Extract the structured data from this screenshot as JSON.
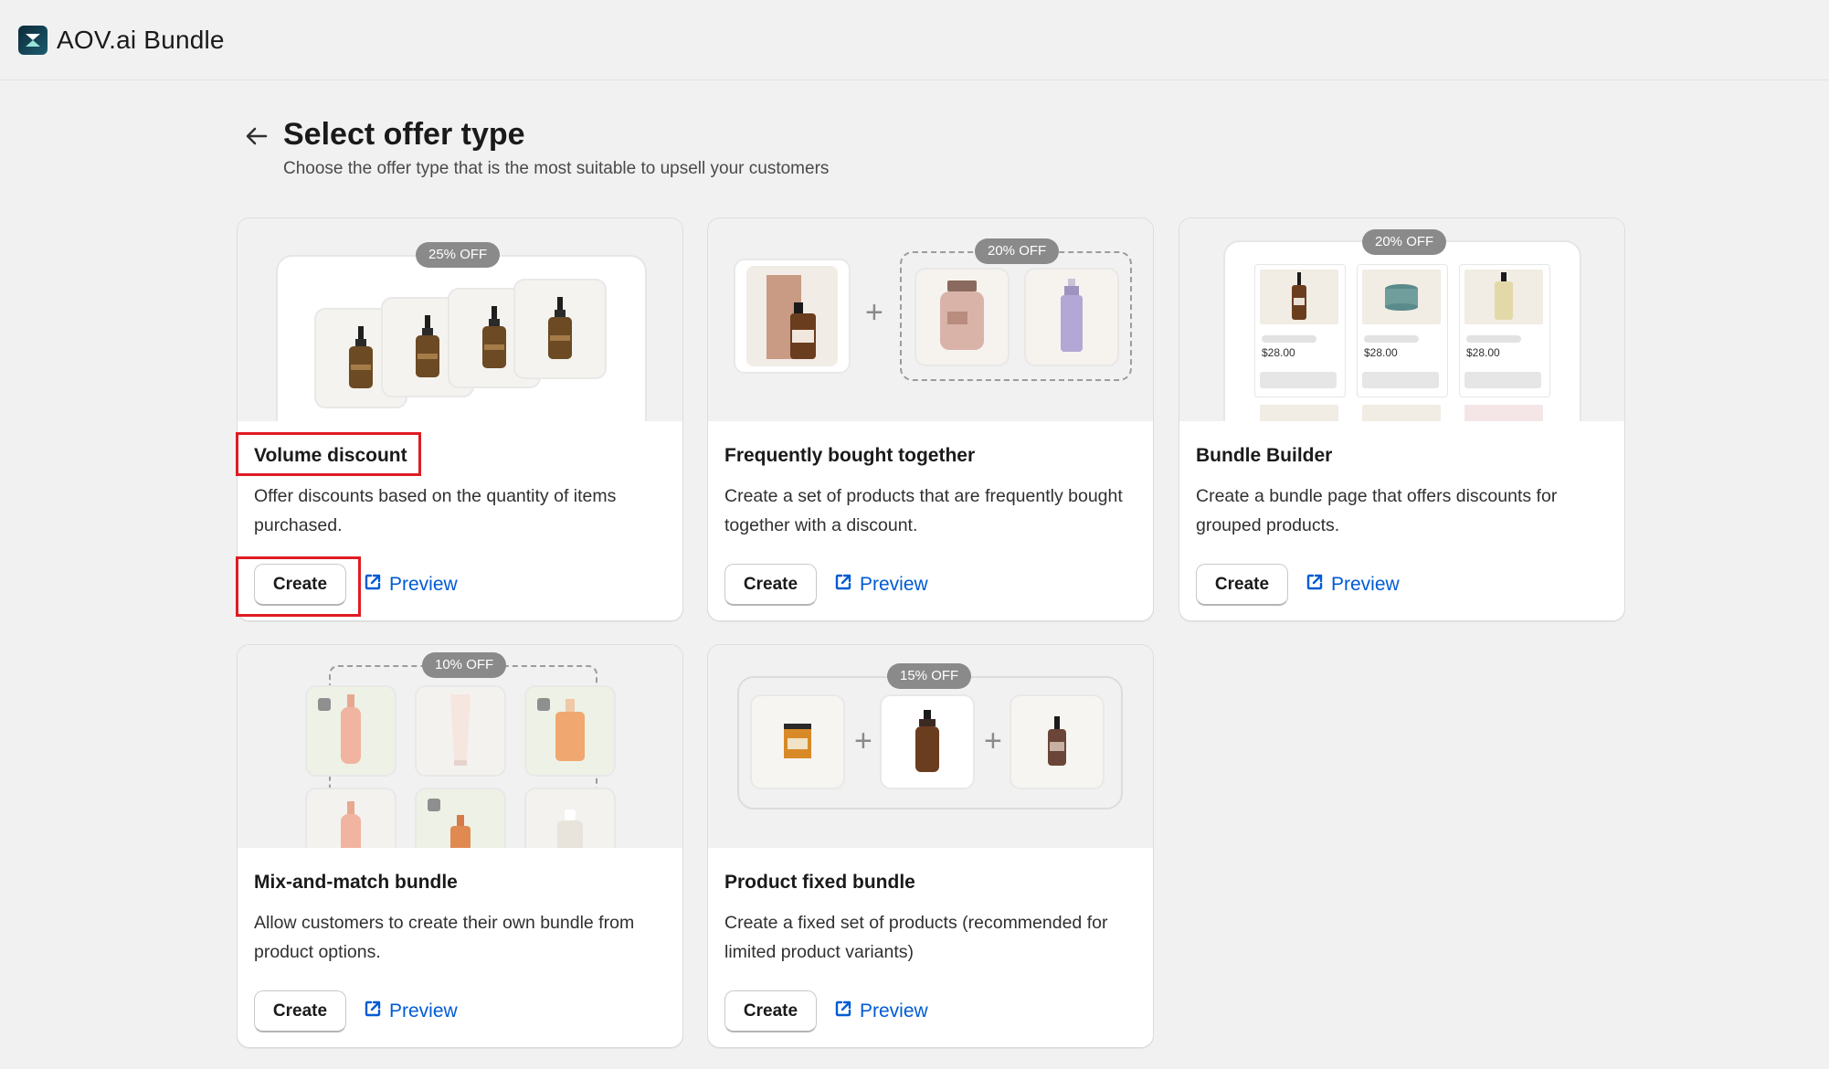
{
  "app": {
    "title": "AOV.ai Bundle"
  },
  "page": {
    "title": "Select offer type",
    "subtitle": "Choose the offer type that is the most suitable to upsell your customers"
  },
  "cards": [
    {
      "title": "Volume discount",
      "description": "Offer discounts based on the quantity of items purchased.",
      "badge": "25% OFF",
      "create_label": "Create",
      "preview_label": "Preview"
    },
    {
      "title": "Frequently bought together",
      "description": "Create a set of products that are frequently bought together with a discount.",
      "badge": "20% OFF",
      "create_label": "Create",
      "preview_label": "Preview"
    },
    {
      "title": "Bundle Builder",
      "description": "Create a bundle page that offers discounts for grouped products.",
      "badge": "20% OFF",
      "create_label": "Create",
      "preview_label": "Preview",
      "prices": [
        "$28.00",
        "$28.00",
        "$28.00"
      ]
    },
    {
      "title": "Mix-and-match bundle",
      "description": "Allow customers to create their own bundle from product options.",
      "badge": "10% OFF",
      "create_label": "Create",
      "preview_label": "Preview"
    },
    {
      "title": "Product fixed bundle",
      "description": "Create a fixed set of products (recommended for limited product variants)",
      "badge": "15% OFF",
      "create_label": "Create",
      "preview_label": "Preview"
    }
  ],
  "colors": {
    "accent_link": "#005bd3",
    "highlight": "#e01b22",
    "badge_bg": "#8a8a8a"
  }
}
